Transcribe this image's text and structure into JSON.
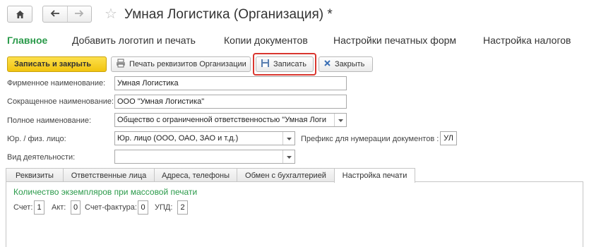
{
  "nav": {
    "home_icon": "home-icon",
    "back_icon": "arrow-left-icon",
    "forward_icon": "arrow-right-icon",
    "star_glyph": "☆"
  },
  "window": {
    "title": "Умная Логистика (Организация) *"
  },
  "sections": [
    {
      "label": "Главное",
      "active": true
    },
    {
      "label": "Добавить логотип и печать"
    },
    {
      "label": "Копии документов"
    },
    {
      "label": "Настройки печатных форм"
    },
    {
      "label": "Настройка налогов"
    }
  ],
  "toolbar": {
    "save_close_label": "Записать и закрыть",
    "print_label": "Печать реквизитов Организации",
    "save_label": "Записать",
    "close_label": "Закрыть"
  },
  "form": {
    "firm_name_label": "Фирменное наименование:",
    "firm_name_value": "Умная Логистика",
    "short_name_label": "Сокращенное наименование:",
    "short_name_value": "ООО \"Умная Логистика\"",
    "full_name_label": "Полное наименование:",
    "full_name_value": "Общество с ограниченной ответственностью \"Умная Логи",
    "entity_type_label": "Юр. / физ. лицо:",
    "entity_type_value": "Юр. лицо (ООО, ОАО, ЗАО и т.д.)",
    "prefix_label": "Префикс для нумерации документов :",
    "prefix_value": "УЛ",
    "activity_label": "Вид деятельности:",
    "activity_value": ""
  },
  "tabs": [
    {
      "label": "Реквизиты"
    },
    {
      "label": "Ответственные лица"
    },
    {
      "label": "Адреса, телефоны"
    },
    {
      "label": "Обмен с бухгалтерией"
    },
    {
      "label": "Настройка печати",
      "active": true
    }
  ],
  "print_settings": {
    "heading": "Количество экземпляров при массовой печати",
    "invoice_label": "Счет:",
    "invoice_value": "1",
    "act_label": "Акт:",
    "act_value": "0",
    "vat_invoice_label": "Счет-фактура:",
    "vat_invoice_value": "0",
    "upd_label": "УПД:",
    "upd_value": "2"
  },
  "colors": {
    "accent_green": "#2a9a4a",
    "primary_button": "#f1c40f",
    "highlight_red": "#d9362f"
  }
}
